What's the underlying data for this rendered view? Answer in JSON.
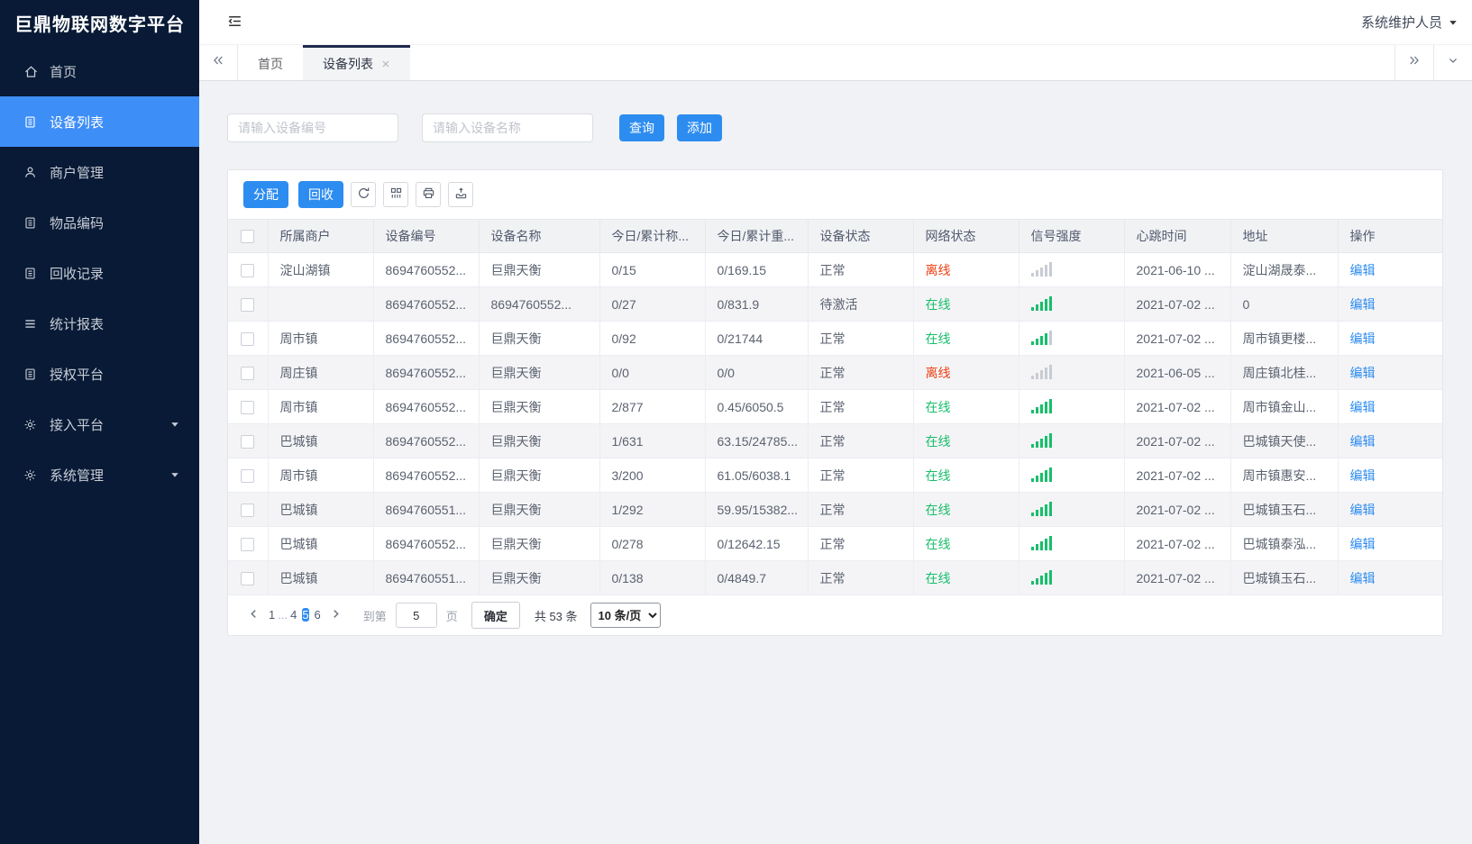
{
  "app": {
    "title": "巨鼎物联网数字平台",
    "user_name": "系统维护人员"
  },
  "sidebar": {
    "items": [
      {
        "id": "home",
        "label": "首页",
        "icon": "home-icon"
      },
      {
        "id": "device-list",
        "label": "设备列表",
        "icon": "doc-icon",
        "active": true
      },
      {
        "id": "merchant-management",
        "label": "商户管理",
        "icon": "user-icon"
      },
      {
        "id": "item-code",
        "label": "物品编码",
        "icon": "doc-icon"
      },
      {
        "id": "recycle-record",
        "label": "回收记录",
        "icon": "doc-icon"
      },
      {
        "id": "statistics-report",
        "label": "统计报表",
        "icon": "list-icon"
      },
      {
        "id": "authorization-platform",
        "label": "授权平台",
        "icon": "doc-icon"
      },
      {
        "id": "access-platform",
        "label": "接入平台",
        "icon": "gear-icon",
        "expandable": true
      },
      {
        "id": "system-management",
        "label": "系统管理",
        "icon": "gear-icon",
        "expandable": true
      }
    ]
  },
  "tabbar": {
    "tabs": [
      {
        "id": "home",
        "label": "首页"
      },
      {
        "id": "device-list",
        "label": "设备列表",
        "active": true,
        "closable": true
      }
    ]
  },
  "search": {
    "device_no_placeholder": "请输入设备编号",
    "device_name_placeholder": "请输入设备名称",
    "query_label": "查询",
    "add_label": "添加"
  },
  "toolbar": {
    "assign_label": "分配",
    "recycle_label": "回收",
    "icon_buttons": [
      "refresh-icon",
      "columns-icon",
      "print-icon",
      "export-icon"
    ]
  },
  "table": {
    "columns": [
      "所属商户",
      "设备编号",
      "设备名称",
      "今日/累计称...",
      "今日/累计重...",
      "设备状态",
      "网络状态",
      "信号强度",
      "心跳时间",
      "地址",
      "操作"
    ],
    "rows": [
      {
        "merchant": "淀山湖镇",
        "device_no": "8694760552...",
        "device_name": "巨鼎天衡",
        "today_count": "0/15",
        "today_weight": "0/169.15",
        "device_status": "正常",
        "network_status": "离线",
        "online": false,
        "signal": 0,
        "heartbeat": "2021-06-10 ...",
        "address": "淀山湖晟泰...",
        "edit_label": "编辑"
      },
      {
        "merchant": "",
        "device_no": "8694760552...",
        "device_name": "8694760552...",
        "today_count": "0/27",
        "today_weight": "0/831.9",
        "device_status": "待激活",
        "network_status": "在线",
        "online": true,
        "signal": 5,
        "heartbeat": "2021-07-02 ...",
        "address": "0",
        "edit_label": "编辑"
      },
      {
        "merchant": "周市镇",
        "device_no": "8694760552...",
        "device_name": "巨鼎天衡",
        "today_count": "0/92",
        "today_weight": "0/21744",
        "device_status": "正常",
        "network_status": "在线",
        "online": true,
        "signal": 4,
        "heartbeat": "2021-07-02 ...",
        "address": "周市镇更楼...",
        "edit_label": "编辑"
      },
      {
        "merchant": "周庄镇",
        "device_no": "8694760552...",
        "device_name": "巨鼎天衡",
        "today_count": "0/0",
        "today_weight": "0/0",
        "device_status": "正常",
        "network_status": "离线",
        "online": false,
        "signal": 0,
        "heartbeat": "2021-06-05 ...",
        "address": "周庄镇北桂...",
        "edit_label": "编辑"
      },
      {
        "merchant": "周市镇",
        "device_no": "8694760552...",
        "device_name": "巨鼎天衡",
        "today_count": "2/877",
        "today_weight": "0.45/6050.5",
        "device_status": "正常",
        "network_status": "在线",
        "online": true,
        "signal": 5,
        "heartbeat": "2021-07-02 ...",
        "address": "周市镇金山...",
        "edit_label": "编辑"
      },
      {
        "merchant": "巴城镇",
        "device_no": "8694760552...",
        "device_name": "巨鼎天衡",
        "today_count": "1/631",
        "today_weight": "63.15/24785...",
        "device_status": "正常",
        "network_status": "在线",
        "online": true,
        "signal": 5,
        "heartbeat": "2021-07-02 ...",
        "address": "巴城镇天使...",
        "edit_label": "编辑"
      },
      {
        "merchant": "周市镇",
        "device_no": "8694760552...",
        "device_name": "巨鼎天衡",
        "today_count": "3/200",
        "today_weight": "61.05/6038.1",
        "device_status": "正常",
        "network_status": "在线",
        "online": true,
        "signal": 5,
        "heartbeat": "2021-07-02 ...",
        "address": "周市镇惠安...",
        "edit_label": "编辑"
      },
      {
        "merchant": "巴城镇",
        "device_no": "8694760551...",
        "device_name": "巨鼎天衡",
        "today_count": "1/292",
        "today_weight": "59.95/15382...",
        "device_status": "正常",
        "network_status": "在线",
        "online": true,
        "signal": 5,
        "heartbeat": "2021-07-02 ...",
        "address": "巴城镇玉石...",
        "edit_label": "编辑"
      },
      {
        "merchant": "巴城镇",
        "device_no": "8694760552...",
        "device_name": "巨鼎天衡",
        "today_count": "0/278",
        "today_weight": "0/12642.15",
        "device_status": "正常",
        "network_status": "在线",
        "online": true,
        "signal": 5,
        "heartbeat": "2021-07-02 ...",
        "address": "巴城镇泰泓...",
        "edit_label": "编辑"
      },
      {
        "merchant": "巴城镇",
        "device_no": "8694760551...",
        "device_name": "巨鼎天衡",
        "today_count": "0/138",
        "today_weight": "0/4849.7",
        "device_status": "正常",
        "network_status": "在线",
        "online": true,
        "signal": 5,
        "heartbeat": "2021-07-02 ...",
        "address": "巴城镇玉石...",
        "edit_label": "编辑"
      }
    ]
  },
  "pagination": {
    "pages": [
      "1",
      "...",
      "4",
      "5",
      "6"
    ],
    "active_page": "5",
    "goto_label": "到第",
    "goto_value": "5",
    "goto_unit": "页",
    "confirm_label": "确定",
    "total_label": "共 53 条",
    "page_size_label": "10 条/页"
  },
  "colors": {
    "primary_blue": "#2d8cf0",
    "sidebar_bg": "#081a35",
    "sidebar_active_blue": "#3e8ef7",
    "online_green": "#19be6b",
    "offline_red": "#ed4014",
    "link_blue": "#2d8cf0"
  }
}
